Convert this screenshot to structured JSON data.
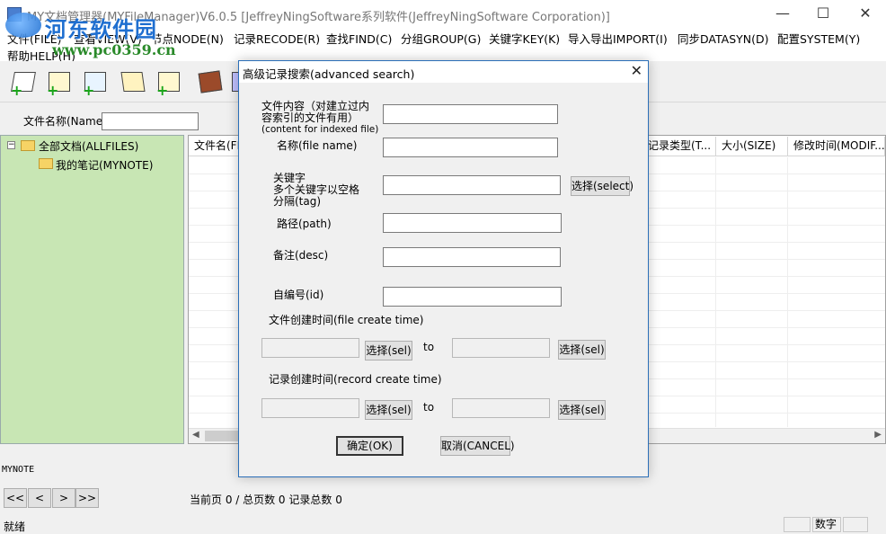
{
  "window": {
    "title": "MY文档管理器(MYFileManager)V6.0.5 [JeffreyNingSoftware系列软件(JeffreyNingSoftware Corporation)]",
    "minimize_glyph": "—",
    "maximize_glyph": "☐",
    "close_glyph": "✕"
  },
  "watermark": {
    "title": "河东软件园",
    "url": "www.pc0359.cn"
  },
  "menu": {
    "items": [
      "文件(FILE)",
      "查看VIEW(V)",
      "节点NODE(N)",
      "记录RECODE(R)",
      "查找FIND(C)",
      "分组GROUP(G)",
      "关键字KEY(K)",
      "导入导出IMPORT(I)",
      "同步DATASYN(D)",
      "配置SYSTEM(Y)"
    ],
    "help": "帮助HELP(H)"
  },
  "toolbar": {
    "icons": [
      "new-document-icon",
      "new-file-icon",
      "new-copy-icon",
      "import-icon",
      "attach-icon",
      "book-icon",
      "calendar-icon"
    ]
  },
  "filter": {
    "name_label": "文件名称(Name)",
    "name_value": ""
  },
  "tree": {
    "root_label": "全部文档(ALLFILES)",
    "child_label": "我的笔记(MYNOTE)",
    "expander": "−"
  },
  "list": {
    "columns": [
      "文件名(FI",
      "记录类型(T...",
      "大小(SIZE)",
      "修改时间(MODIF..."
    ]
  },
  "bottom": {
    "mynote_label": "MYNOTE",
    "pager": [
      "<<",
      "<",
      ">",
      ">>"
    ],
    "page_status": "当前页 0 / 总页数 0 记录总数 0",
    "status_text": "就绪",
    "status_numlock": "数字"
  },
  "dialog": {
    "title": "高级记录搜索(advanced search)",
    "close_glyph": "✕",
    "content_label_line1": "文件内容（对建立过内",
    "content_label_line2": "容索引的文件有用）",
    "content_label_line3": "(content for indexed file)",
    "content_value": "",
    "filename_label": "名称(file name)",
    "filename_value": "",
    "tag_label_line1": "关键字",
    "tag_label_line2": "多个关键字以空格",
    "tag_label_line3": "分隔(tag)",
    "tag_value": "",
    "tag_select": "选择(select)",
    "path_label": "路径(path)",
    "path_value": "",
    "desc_label": "备注(desc)",
    "desc_value": "",
    "id_label": "自编号(id)",
    "id_value": "",
    "file_time_label": "文件创建时间(file create time)",
    "record_time_label": "记录创建时间(record create time)",
    "sel_button": "选择(sel)",
    "to_label": "to",
    "ok_button": "确定(OK)",
    "cancel_button": "取消(CANCEL)"
  }
}
